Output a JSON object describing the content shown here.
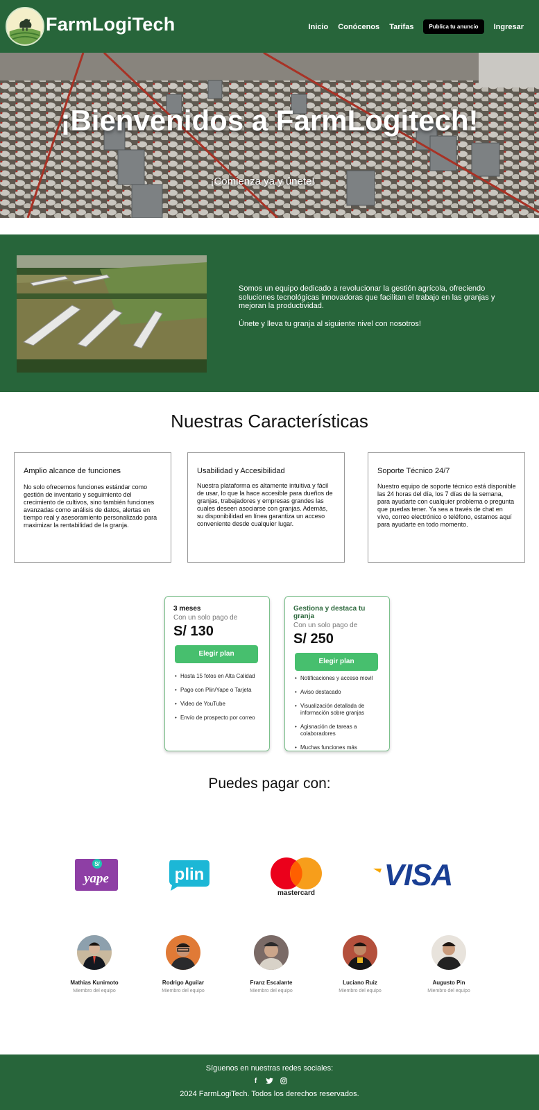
{
  "nav": {
    "brand": "FarmLogiTech",
    "links": [
      "Inicio",
      "Conócenos",
      "Tarifas"
    ],
    "cta": "Publica tu anuncio",
    "login": "Ingresar"
  },
  "hero": {
    "title": "¡Bienvenidos a FarmLogitech!",
    "subtitle": "¡Comienza ya y únete!"
  },
  "about": {
    "p1": "Somos un equipo dedicado a revolucionar la gestión agrícola, ofreciendo soluciones tecnológicas innovadoras que facilitan el trabajo en las granjas y mejoran la productividad.",
    "p2": "Únete y lleva tu granja al siguiente nivel con nosotros!"
  },
  "features": {
    "title": "Nuestras Características",
    "cards": [
      {
        "title": "Amplio alcance de funciones",
        "text": " No solo ofrecemos funciones estándar como gestión de inventario y seguimiento del crecimiento de cultivos, sino también funciones avanzadas como análisis de datos, alertas en tiempo real y asesoramiento personalizado para maximizar la rentabilidad de la granja."
      },
      {
        "title": "Usabilidad y Accesibilidad",
        "text": " Nuestra plataforma es altamente intuitiva y fácil de usar, lo que la hace accesible para dueños de granjas, trabajadores y empresas grandes las cuales deseen asociarse con granjas. Además, su disponibilidad en línea garantiza un acceso conveniente desde cualquier lugar."
      },
      {
        "title": "Soporte Técnico 24/7",
        "text": "Nuestro equipo de soporte técnico está disponible las 24 horas del día, los 7 días de la semana, para ayudarte con cualquier problema o pregunta que puedas tener. Ya sea a través de chat en vivo, correo electrónico o teléfono, estamos aquí para ayudarte en todo momento."
      }
    ]
  },
  "plans": [
    {
      "name": "3 meses",
      "sub": "Con un solo pago de",
      "price": "S/ 130",
      "button": "Elegir plan",
      "items": [
        "Hasta 15 fotos en Alta Calidad",
        "Pago con Plin/Yape o Tarjeta",
        "Video de YouTube",
        "Envío de prospecto por correo"
      ]
    },
    {
      "name": "Gestiona y destaca tu granja",
      "sub": "Con un solo pago de",
      "price": "S/ 250",
      "button": "Elegir plan",
      "items": [
        "Notificaciones y acceso movil",
        "Aviso destacado",
        "Visualización detallada de información sobre granjas",
        "Agisnación de tareas a colaboradores",
        "Muchas funciones más"
      ]
    }
  ],
  "payments": {
    "title": "Puedes pagar con:",
    "logos": [
      {
        "name": "yape",
        "color": "#8e3fa5"
      },
      {
        "name": "plin",
        "color": "#1cb7d6"
      },
      {
        "name": "mastercard",
        "color": "#eb001b"
      },
      {
        "name": "VISA",
        "color": "#1a3f94"
      }
    ]
  },
  "team": [
    {
      "name": "Mathias Kunimoto",
      "role": "Miembro del equipo"
    },
    {
      "name": "Rodrigo Aguilar",
      "role": "Miembro del equipo"
    },
    {
      "name": "Franz Escalante",
      "role": "Miembro del equipo"
    },
    {
      "name": "Luciano Ruiz",
      "role": "Miembro del equipo"
    },
    {
      "name": "Augusto Pin",
      "role": "Miembro del equipo"
    }
  ],
  "footer": {
    "follow": "Síguenos en nuestras redes sociales:",
    "socials": [
      "f",
      "t",
      "ig"
    ],
    "copyright": "2024 FarmLogiTech. Todos los derechos reservados."
  },
  "colors": {
    "brand_green": "#27653a",
    "button_green": "#47bf6e",
    "plan_border": "#7cc08c"
  }
}
